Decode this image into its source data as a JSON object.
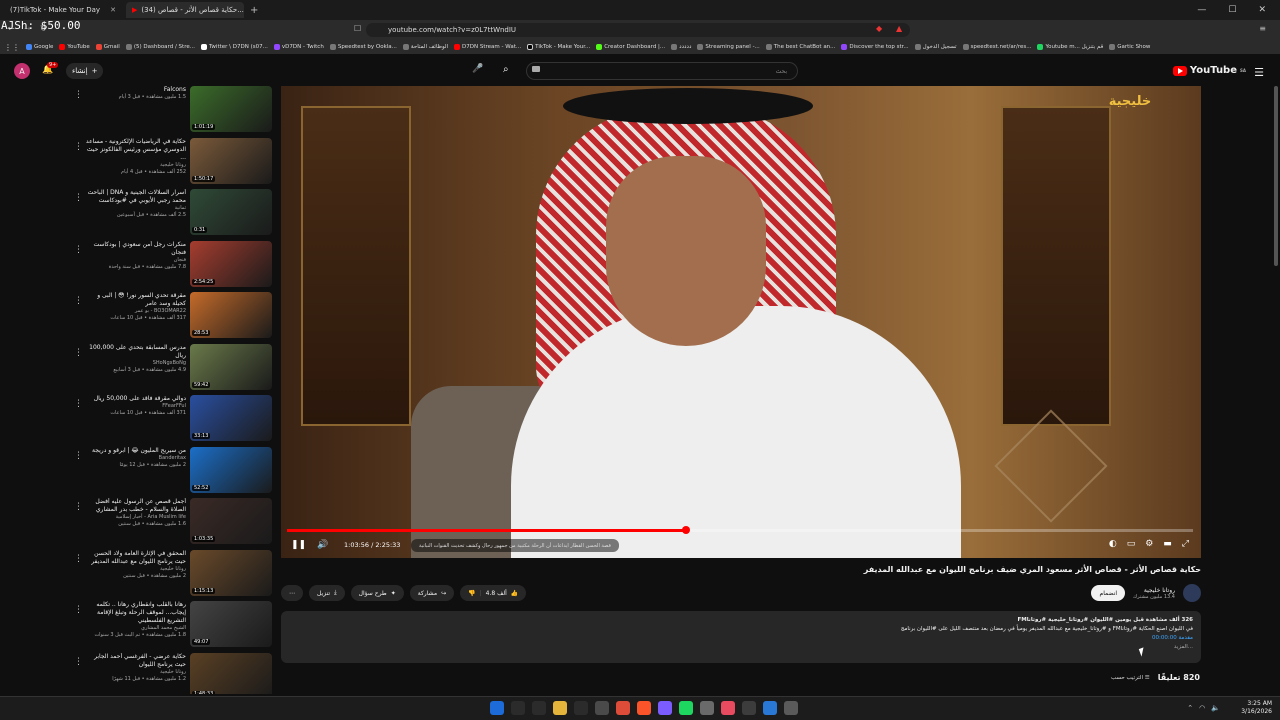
{
  "overlay": {
    "text": "AJSh: $50.00"
  },
  "tabs": [
    {
      "label": "(7)TikTok - Make Your Day"
    },
    {
      "label": "(34) حكاية قصاص الأثر - قصاص..."
    }
  ],
  "address": {
    "url": "youtube.com/watch?v=z0L7ttWndIU"
  },
  "bookmarks": [
    "Google",
    "YouTube",
    "Gmail",
    "(5) Dashboard / Stre...",
    "Twitter \\ D7DN (s07...",
    "vD7DN - Twitch",
    "Speedtest by Ookla...",
    "الوظائف المتاحة",
    "D7DN Stream - Wat...",
    "TikTok - Make Your...",
    "Creator Dashboard |...",
    "ددددد",
    "Streaming panel -...",
    "The best ChatBot an...",
    "Discover the top str...",
    "تسجيل الدخول",
    "speedtest.net/ar/res...",
    "Youtube m... قم بتنزيل",
    "Gartic Show"
  ],
  "header": {
    "logo": "YouTube",
    "logo_region": "SA",
    "search_placeholder": "بحث",
    "create_label": "إنشاء",
    "notifications": "9+",
    "avatar": "A"
  },
  "sidebar": {
    "items": [
      {
        "title": "Falcons",
        "channel": "",
        "meta": "1.5 مليون مشاهدة • قبل 3 أيام",
        "dur": "1:01:19",
        "color": "#3b6c2a"
      },
      {
        "title": "حكاية في الرياضيات الإلكترونية - مساعد الدوسري مؤسس ورئيس الفالكونز حيث ...",
        "channel": "روتانا خليجية",
        "meta": "252 ألف مشاهدة • قبل 4 أيام",
        "dur": "1:50:17",
        "color": "#7b5a3a"
      },
      {
        "title": "أسرار السلالات الجينية و DNA | الباحث محمد رجبي الأيوبي في #بودكاست",
        "channel": "ثمانية",
        "meta": "2.5 ألف مشاهدة • قبل أسبوعين",
        "dur": "0:31",
        "color": "#2f4a37"
      },
      {
        "title": "منكرات رجل أمن سعودي | بودكاست فنجان",
        "channel": "فنجان",
        "meta": "7.8 مليون مشاهدة • قبل سنة واحدة",
        "dur": "2:54:25",
        "color": "#a63d2f"
      },
      {
        "title": "مقرقة تحدي السور نور! 😳 | البى و كحيلة وسد عامر",
        "channel": "BO3OMAR22 - بو عمر",
        "meta": "317 ألف مشاهدة • قبل 10 ساعات",
        "dur": "28:53",
        "color": "#c56b2a"
      },
      {
        "title": "مدرس المسابقة بتحدي على 100,000 ريال",
        "channel": "SHoNgxBoNg",
        "meta": "4.9 مليون مشاهدة • قبل 3 أسابيع",
        "dur": "59:42",
        "color": "#6a7a4a"
      },
      {
        "title": "دوالي مقرقة فاقد على 50,000 ريال",
        "channel": "FFearFFul",
        "meta": "371 ألف مشاهدة • قبل 10 ساعات",
        "dur": "33:13",
        "color": "#2a4fa0"
      },
      {
        "title": "من سيربح المليون 😂 | ابرقو و دريجة",
        "channel": "Banderitax",
        "meta": "2 مليون مشاهدة • قبل 12 يومًا",
        "dur": "52:52",
        "color": "#1b6fc9"
      },
      {
        "title": "أجمل قصص عن الرسول عليه أفضل الصلاة والسلام - خطب بدر المشاري",
        "channel": "Aria Muslim life - أخبار إسلامية",
        "meta": "1.6 مليون مشاهدة • قبل سنتين",
        "dur": "1:03:35",
        "color": "#3a2a26"
      },
      {
        "title": "المحقق في الإثارة العامة ولاد الحسن حيث يرنامج الليوان مع عبدالله المديفر",
        "channel": "روتانا خليجية",
        "meta": "2 مليون مشاهدة • قبل سنتين",
        "dur": "1:15:13",
        "color": "#6a4a2a"
      },
      {
        "title": "رهانا بالقلب وانقطاري رهانا .. تكلمه إيجاب... لموقف الرحلة وتبلغ الإقامة التشريع الفلسطيني",
        "channel": "الشيخ محمد المشاري",
        "meta": "1.8 مليون مشاهدة • تم البث قبل 3 سنوات",
        "dur": "49:07",
        "color": "#444444"
      },
      {
        "title": "حكاية عرضي - الفرغسي أحمد الجابر حيث يرنامج الليوان",
        "channel": "روتانا خليجية",
        "meta": "1.2 مليون مشاهدة • قبل 11 شهرًا",
        "dur": "1:48:33",
        "color": "#5a4024"
      }
    ]
  },
  "player": {
    "time": "1:03:56 / 2:25:33",
    "chapter": "قصة الحسن القطار ايداعات أن الرحلة مكتبية من جمهور رحال وكشف تحديث القنوات النباتية",
    "channel_bug": "خليجية",
    "progress": 0.44
  },
  "video": {
    "title": "حكاية قصاص الأثر - قصاص الأثر مسعود المري ضيف برنامج الليوان مع عبدالله المديفر",
    "channel_name": "روتانا خليجية",
    "subscribers": "13.4 مليون مشترك",
    "join_label": "انضمام",
    "likes": "4.8 ألف",
    "share_label": "مشاركة",
    "ask_label": "طرح سؤال",
    "download_label": "تنزيل",
    "more_label": "⋯"
  },
  "description": {
    "line1": "326 ألف مشاهدة  قبل يومين  #الليوان #روتانا_خليجية #روتاناFM",
    "line2": "في الليوان اصنع الحكاية #روتاناFM و #روتانا_خليجية مع عبدالله المديفر يومياً في رمضان بعد منتصف الليل على #الليوان برنامج",
    "line3": "مقدمة 00:00:00",
    "more": "...المزيد"
  },
  "comments": {
    "count": "820 تعليقًا",
    "sort_label": "الترتيب حسب"
  },
  "clock": {
    "time": "3:25 AM",
    "date": "3/16/2026"
  },
  "taskbar_colors": [
    "#1c6bd8",
    "#2b2b2b",
    "#2b2b2b",
    "#e5b43a",
    "#2b2b2b",
    "#4a4a4a",
    "#dd4b39",
    "#fb542b",
    "#7b5cff",
    "#1ed760",
    "#6a6a6a",
    "#e84a5f",
    "#3c3c3c",
    "#2a78d6",
    "#5a5a5a"
  ]
}
